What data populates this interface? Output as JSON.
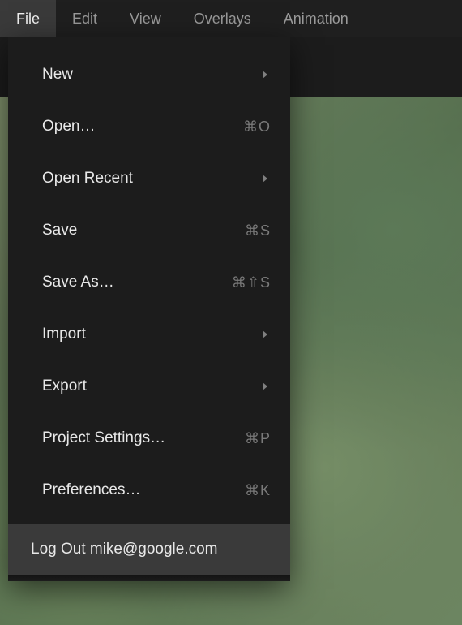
{
  "menubar": {
    "tabs": [
      {
        "label": "File",
        "active": true
      },
      {
        "label": "Edit",
        "active": false
      },
      {
        "label": "View",
        "active": false
      },
      {
        "label": "Overlays",
        "active": false
      },
      {
        "label": "Animation",
        "active": false
      }
    ]
  },
  "dropdown": {
    "items": [
      {
        "label": "New",
        "submenu": true
      },
      {
        "label": "Open…",
        "shortcut": "⌘O"
      },
      {
        "label": "Open Recent",
        "submenu": true
      },
      {
        "label": "Save",
        "shortcut": "⌘S"
      },
      {
        "label": "Save As…",
        "shortcut": "⌘⇧S"
      },
      {
        "label": "Import",
        "submenu": true
      },
      {
        "label": "Export",
        "submenu": true
      },
      {
        "label": "Project Settings…",
        "shortcut": "⌘P"
      },
      {
        "label": "Preferences…",
        "shortcut": "⌘K"
      }
    ],
    "logout": {
      "label": "Log Out mike@google.com"
    }
  }
}
